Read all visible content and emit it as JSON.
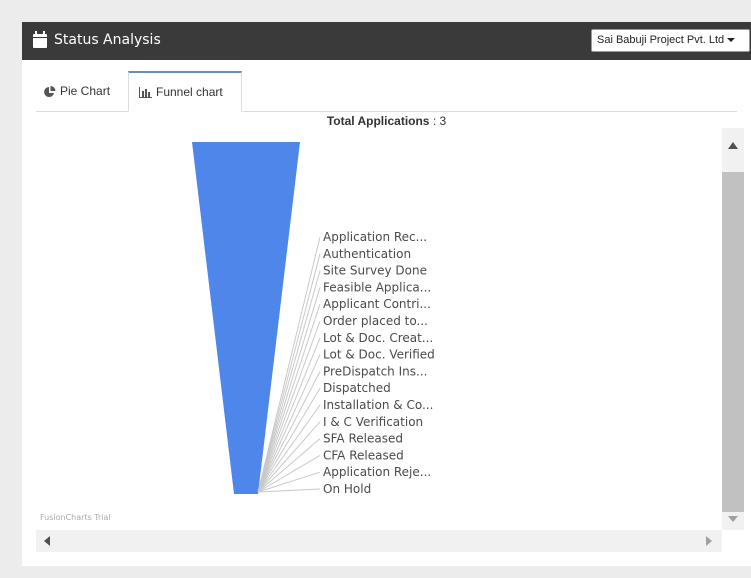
{
  "header": {
    "title": "Status Analysis",
    "company_select": "Sai Babuji Project Pvt. Ltd"
  },
  "tabs": [
    {
      "label": "Pie Chart",
      "active": false
    },
    {
      "label": "Funnel chart",
      "active": true
    }
  ],
  "watermark": "FusionCharts Trial",
  "colors": {
    "funnel": "#4f86ea",
    "header": "#3a3a3a",
    "leader": "#c8c8c8"
  },
  "chart_data": {
    "type": "funnel",
    "title": "Total Applications",
    "total_value": "3",
    "categories": [
      "Application Rec...",
      "Authentication",
      "Site Survey Done",
      "Feasible Applica...",
      "Applicant Contri...",
      "Order placed to...",
      "Lot & Doc. Creat...",
      "Lot & Doc. Verified",
      "PreDispatch Ins...",
      "Dispatched",
      "Installation & Co...",
      "I & C Verification",
      "SFA Released",
      "CFA Released",
      "Application Reje...",
      "On Hold"
    ],
    "values": [
      3,
      0,
      0,
      0,
      0,
      0,
      0,
      0,
      0,
      0,
      0,
      0,
      0,
      0,
      0,
      0
    ]
  }
}
